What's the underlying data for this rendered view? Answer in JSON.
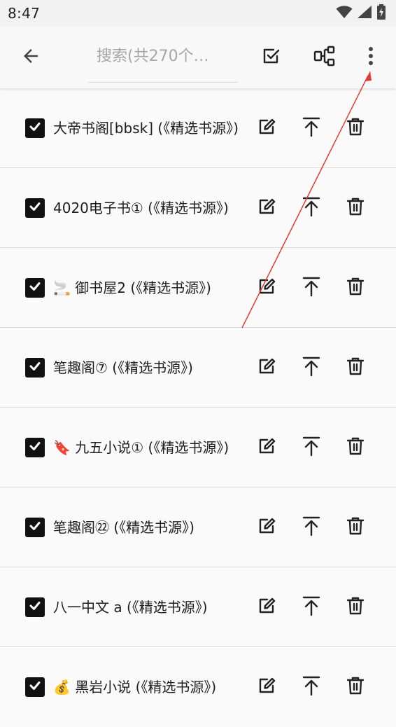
{
  "status_bar": {
    "time": "8:47"
  },
  "toolbar": {
    "search_placeholder": "搜索(共270个…"
  },
  "sources": [
    {
      "title": "大帝书阁[bbsk] (《精选书源》)"
    },
    {
      "title": "4020电子书① (《精选书源》)"
    },
    {
      "title": "🚬 御书屋2 (《精选书源》)"
    },
    {
      "title": "笔趣阁⑦ (《精选书源》)"
    },
    {
      "title": "🔖 九五小说① (《精选书源》)"
    },
    {
      "title": "笔趣阁㉒ (《精选书源》)"
    },
    {
      "title": "八一中文 a (《精选书源》)"
    },
    {
      "title": "💰 黑岩小说 (《精选书源》)"
    }
  ]
}
